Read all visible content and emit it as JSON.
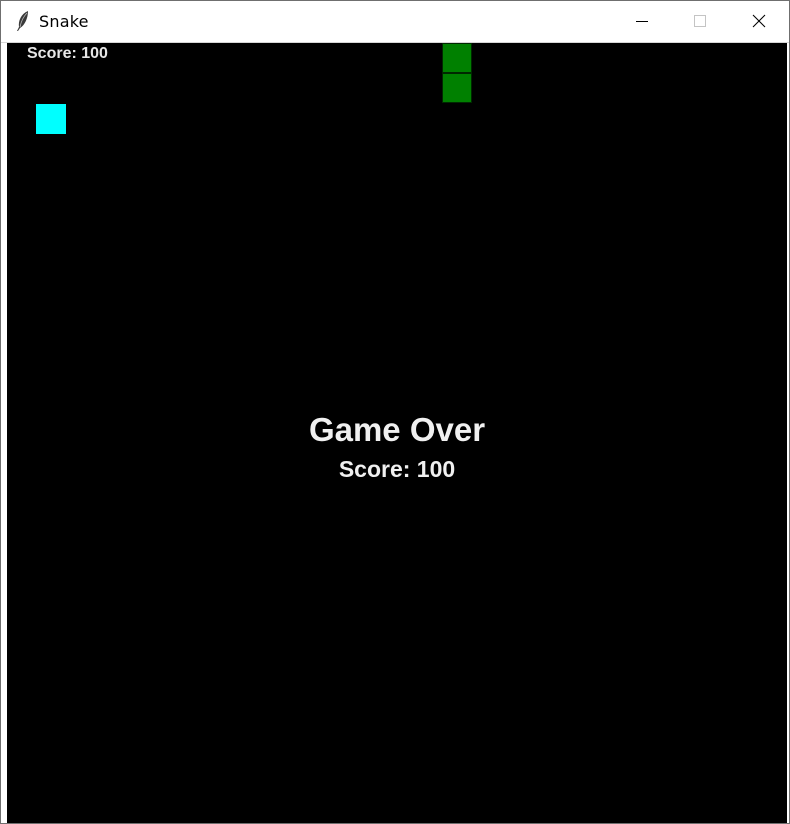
{
  "window": {
    "title": "Snake",
    "icon": "feather-icon",
    "controls": {
      "minimize": "minimize-icon",
      "maximize": "maximize-icon",
      "close": "close-icon"
    }
  },
  "game": {
    "hud_score": "Score: 100",
    "game_over_text": "Game Over",
    "final_score": "Score: 100",
    "colors": {
      "background": "#000000",
      "food": "#00ffff",
      "snake": "#008000",
      "text": "#f0f0f0"
    }
  }
}
